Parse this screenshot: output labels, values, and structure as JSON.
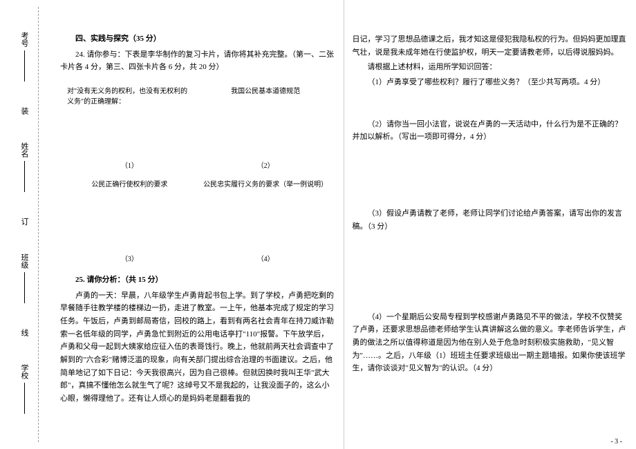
{
  "binding": {
    "f1": "学校",
    "f2": "班级",
    "m1": "线",
    "f3": "姓名",
    "m2": "订",
    "f4": "考号",
    "m3": "装"
  },
  "section4_title": "四、实践与探究（35 分）",
  "q24_intro": "24. 请你参与：下表是李华制作的复习卡片，请你将其补充完整。（第一、二张卡片各 4 分，第三、四张卡片各 6 分，共 20 分）",
  "card": {
    "c1": "对\"没有无义务的权利，也没有无权利的义务\"的正确理解：",
    "n1": "（1）",
    "c2": "我国公民基本道德规范",
    "n2": "（2）",
    "c3": "公民正确行使权利的要求",
    "n3": "（3）",
    "c4": "公民忠实履行义务的要求（举一例说明）",
    "n4": "（4）"
  },
  "q25_title": "25. 请你分析：（共 15 分）",
  "q25_body1": "卢勇的一天：早晨，八年级学生卢勇背起书包上学。到了学校，卢勇把吃剩的早餐随手往教学楼的楼梯边一扔，走进了教室。一上午，他基本完成了规定的学习任务。午饭后，卢勇到邮局寄信，回校的路上，看到有两名社会青年在持刀威诈勒索一名低年级的同学，卢勇急忙到附近的公用电话亭打\"110\"报警。下午放学后，卢勇和父母一起到大姨家给应征入伍的表哥饯行。晚上，他就前两天社会调查中了解到的\"六合彩\"赌博泛滥的现象，向有关部门提出综合治理的书面建议。之后，他简单地记了如下日记：今天我很高兴，因为自己很棒。但就因换时我叫王华\"武大郎\"，真搞不懂他怎么就生气了呢？这绰号又不是我起的，让我没面子的，这么小心眼，懒得理他了。还有让人烦心的是妈妈老是翻看我的",
  "q25_body2": "日记，学习了思想品德课之后，我才知这是侵犯我隐私权的行为。但妈妈更加理直气壮，说是我未成年她在行使监护权，明天一定要请教老师，以后得说服妈妈。",
  "q25_prompt": "请根据上述材料，运用所学知识回答：",
  "sub1": "（1）卢勇享受了哪些权利？履行了哪些义务？（至少共写两项。4 分）",
  "sub2": "（2）请你当一回小法官，说说在卢勇的一天活动中，什么行为是不正确的？并加以解析。（写出一项即可得分，4 分）",
  "sub3": "（3）假设卢勇请教了老师，老师让同学们讨论给卢勇答案，请写出你的发言稿。（3 分）",
  "sub4": "（4）一个星期后公安局专程到学校感谢卢勇路见不平的做法，学校不仅赞奖了卢勇，还要求思想品德老师给学生认真讲解这么做的意义。李老师告诉学生，卢勇的做法之所以值得称道是因为他在别人处于危急时刻积极实施救助，\"见义智为\"……。之后，八年级（1）班班主任要求班级出一期主题墙报。如果你使该班学生，请你谈谈对\"见义智为\"的认识。（4 分）",
  "page": "- 3 -"
}
